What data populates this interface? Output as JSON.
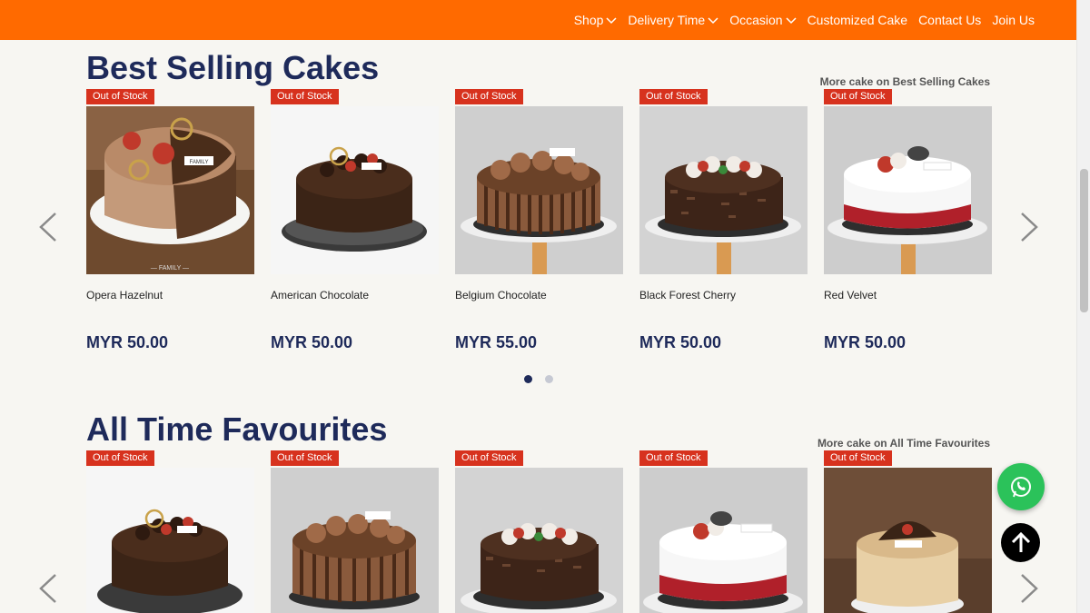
{
  "header": {
    "nav": [
      {
        "label": "Shop",
        "dropdown": true
      },
      {
        "label": "Delivery Time",
        "dropdown": true
      },
      {
        "label": "Occasion",
        "dropdown": true
      },
      {
        "label": "Customized Cake",
        "dropdown": false
      },
      {
        "label": "Contact Us",
        "dropdown": false
      },
      {
        "label": "Join Us",
        "dropdown": false
      }
    ],
    "accent_color": "#ff6a00"
  },
  "best_selling": {
    "title": "Best Selling Cakes",
    "more_link": "More cake on Best Selling Cakes",
    "products": [
      {
        "badge": "Out of Stock",
        "name": "Opera Hazelnut",
        "price": "MYR 50.00",
        "image": "opera-hazelnut-cake"
      },
      {
        "badge": "Out of Stock",
        "name": "American Chocolate",
        "price": "MYR 50.00",
        "image": "american-chocolate-cake"
      },
      {
        "badge": "Out of Stock",
        "name": "Belgium Chocolate",
        "price": "MYR 55.00",
        "image": "belgium-chocolate-cake"
      },
      {
        "badge": "Out of Stock",
        "name": "Black Forest Cherry",
        "price": "MYR 50.00",
        "image": "black-forest-cherry-cake"
      },
      {
        "badge": "Out of Stock",
        "name": "Red Velvet",
        "price": "MYR 50.00",
        "image": "red-velvet-cake"
      }
    ],
    "pager": {
      "pages": 2,
      "active": 0
    }
  },
  "favourites": {
    "title": "All Time Favourites",
    "more_link": "More cake on All Time Favourites",
    "products": [
      {
        "badge": "Out of Stock",
        "image": "american-chocolate-cake"
      },
      {
        "badge": "Out of Stock",
        "image": "belgium-chocolate-cake"
      },
      {
        "badge": "Out of Stock",
        "image": "black-forest-cherry-cake"
      },
      {
        "badge": "Out of Stock",
        "image": "red-velvet-cake"
      },
      {
        "badge": "Out of Stock",
        "image": "cheese-cake"
      }
    ]
  },
  "floating": {
    "whatsapp_icon": "whatsapp-icon",
    "back_to_top_icon": "arrow-up-icon"
  },
  "colors": {
    "title": "#1e2a5a",
    "badge": "#d7321e",
    "whatsapp": "#2bc25a"
  }
}
